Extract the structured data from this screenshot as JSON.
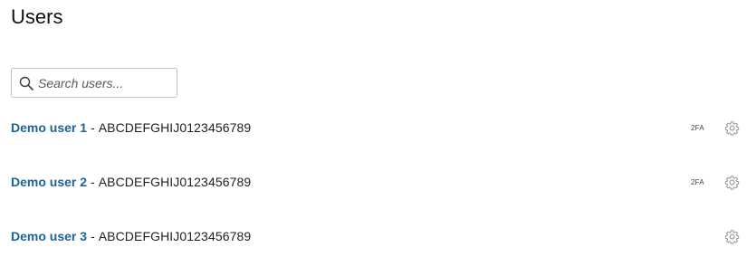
{
  "page": {
    "title": "Users"
  },
  "search": {
    "placeholder": "Search users...",
    "value": "",
    "icon": "search-icon"
  },
  "users": [
    {
      "name": "Demo user 1",
      "separator": "-",
      "id": "ABCDEFGHIJ0123456789",
      "badge": "2FA",
      "settings_icon": "gear-icon"
    },
    {
      "name": "Demo user 2",
      "separator": "-",
      "id": "ABCDEFGHIJ0123456789",
      "badge": "2FA",
      "settings_icon": "gear-icon"
    },
    {
      "name": "Demo user 3",
      "separator": "-",
      "id": "ABCDEFGHIJ0123456789",
      "badge": "",
      "settings_icon": "gear-icon"
    }
  ],
  "colors": {
    "link": "#1a6496",
    "text": "#1f1f1f",
    "border": "#bfc3c7",
    "icon": "#8a8f94"
  }
}
